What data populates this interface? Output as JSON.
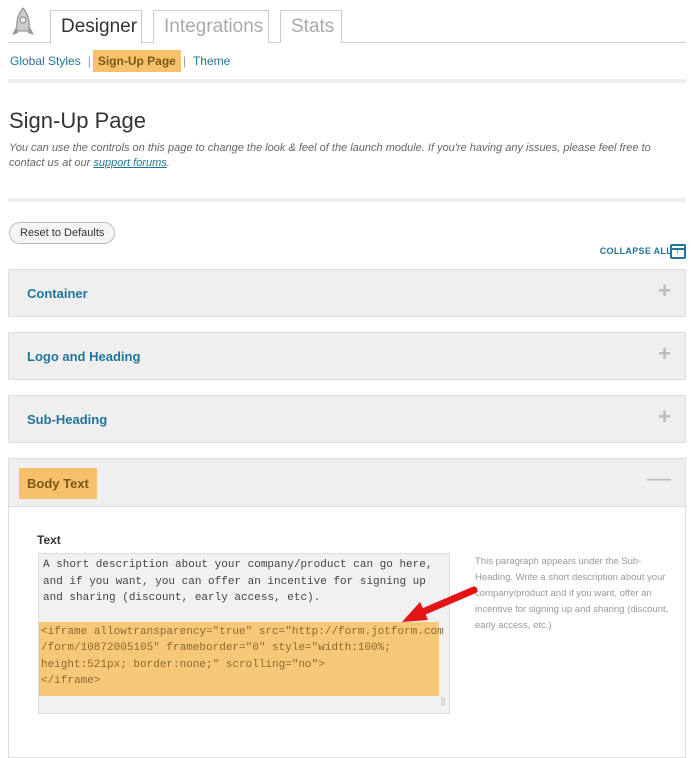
{
  "tabs": [
    {
      "label": "Designer"
    },
    {
      "label": "Integrations"
    },
    {
      "label": "Stats"
    }
  ],
  "subnav": {
    "items": [
      "Global Styles",
      "Sign-Up Page",
      "Theme"
    ],
    "sep": "|"
  },
  "page": {
    "title": "Sign-Up Page",
    "intro": "You can use the controls on this page to change the look & feel of the launch module. If you're having any issues, please feel free to contact us at our ",
    "intro_link": "support forums",
    "intro_end": "."
  },
  "reset_label": "Reset to Defaults",
  "collapse_all": "COLLAPSE ALL",
  "panels": [
    {
      "title": "Container",
      "icon": "+"
    },
    {
      "title": "Logo and Heading",
      "icon": "+"
    },
    {
      "title": "Sub-Heading",
      "icon": "+"
    }
  ],
  "open_panel": {
    "title": "Body Text",
    "icon": "—",
    "field_label": "Text",
    "text": "A short description about your company/product can go here,\nand if you want, you can offer an incentive for signing up\nand sharing (discount, early access, etc).",
    "code": "<iframe allowtransparency=\"true\" src=\"http://form.jotform.com\n/form/10872005105\" frameborder=\"0\" style=\"width:100%;\nheight:521px; border:none;\" scrolling=\"no\">\n</iframe>",
    "help": "This paragraph appears under the Sub-Heading. Write a short description about your company/product and if you want, offer an incentive for signing up and sharing (discount, early access, etc.)"
  },
  "colors": {
    "accent": "#21759b",
    "highlight": "#f7c16c",
    "arrow": "#e31414"
  }
}
